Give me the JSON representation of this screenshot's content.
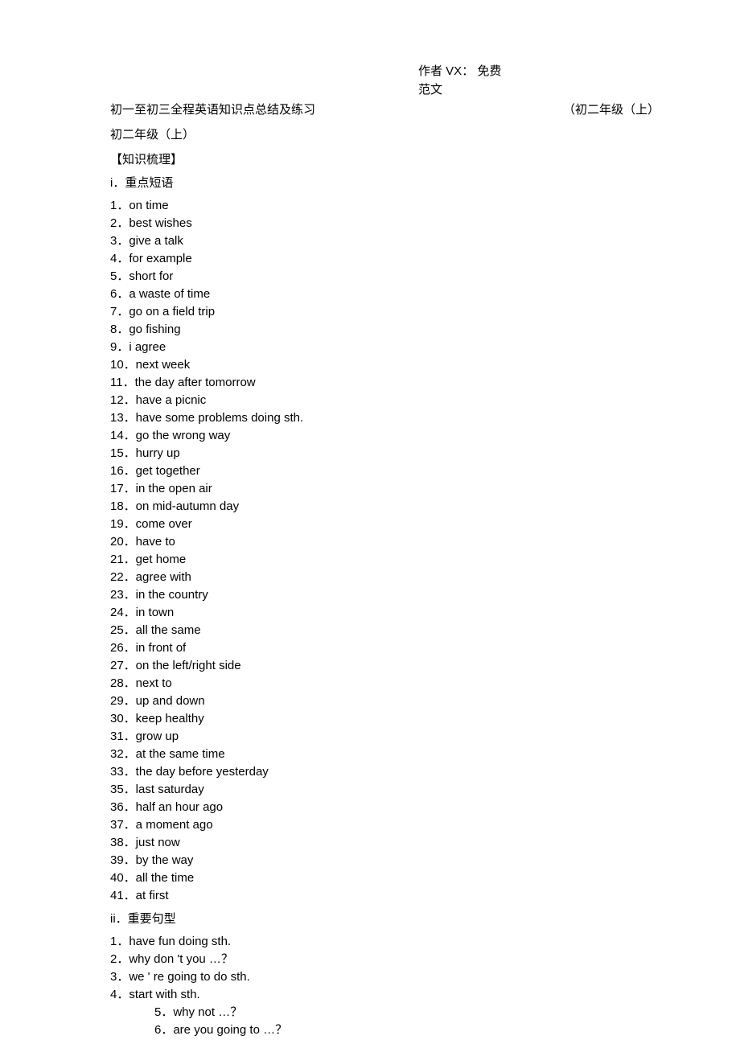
{
  "header": {
    "line1": "作者 VX： 免费",
    "line2": "范文"
  },
  "title": {
    "left": "初一至初三全程英语知识点总结及练习",
    "right": "（初二年级（上）"
  },
  "subtitle": "初二年级（上）",
  "section_outline": "【知识梳理】",
  "section_i": {
    "label": "i．重点短语",
    "items": [
      "1．on time",
      "2．best wishes",
      "3．give a talk",
      "4．for example",
      "5．short for",
      "6．a waste of time",
      "7．go on a field trip",
      "8．go fishing",
      "9．i agree",
      "10．next week",
      "11．the day after tomorrow",
      "12．have a picnic",
      "13．have some problems doing sth.",
      "14．go the wrong way",
      "15．hurry up",
      "16．get together",
      "17．in the open air",
      "18．on mid-autumn day",
      "19．come over",
      "20．have to",
      "21．get home",
      "22．agree with",
      "23．in the country",
      "24．in town",
      "25．all the same",
      "26．in front of",
      "27．on the left/right side",
      "28．next to",
      "29．up and down",
      "30．keep healthy",
      "31．grow up",
      "32．at the same time",
      "33．the day before yesterday",
      "35．last saturday",
      "36．half an hour ago",
      "37．a moment ago",
      "38．just now",
      "39．by the way",
      "40．all the time",
      "41．at first"
    ]
  },
  "section_ii": {
    "label": "ii．重要句型",
    "items": [
      "1．have fun doing sth.",
      "2．why don 't you …？",
      "3．we ' re going to do sth.",
      "4．start with sth.",
      "5．why not …？",
      "6．are you going to …？"
    ]
  }
}
